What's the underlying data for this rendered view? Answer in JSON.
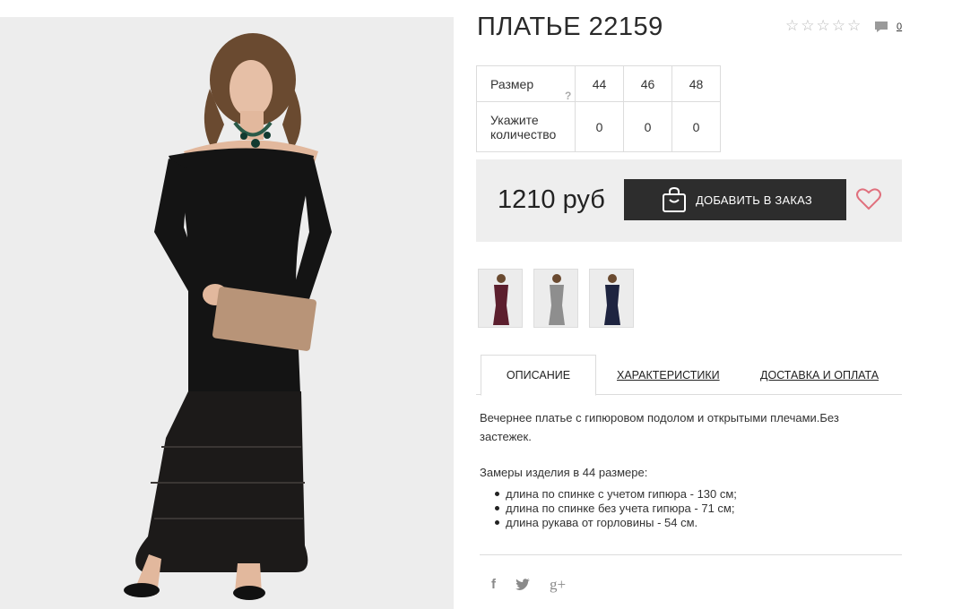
{
  "product": {
    "title": "ПЛАТЬЕ 22159",
    "rating_stars": 5,
    "rating_value": 0,
    "comment_count": "0"
  },
  "size_table": {
    "size_label": "Размер",
    "help_mark": "?",
    "sizes": [
      "44",
      "46",
      "48"
    ],
    "qty_label": "Укажите количество",
    "quantities": [
      "0",
      "0",
      "0"
    ]
  },
  "purchase": {
    "price": "1210 руб",
    "add_button_label": "ДОБАВИТЬ В ЗАКАЗ",
    "heart_color": "#e0707d"
  },
  "thumbnails": [
    {
      "name": "thumb-burgundy",
      "color": "#5c1f2e"
    },
    {
      "name": "thumb-grey",
      "color": "#8e8e8e"
    },
    {
      "name": "thumb-navy",
      "color": "#1e2440"
    }
  ],
  "tabs": [
    {
      "label": "ОПИСАНИЕ",
      "active": true
    },
    {
      "label": "ХАРАКТЕРИСТИКИ",
      "active": false
    },
    {
      "label": "ДОСТАВКА И ОПЛАТА",
      "active": false
    }
  ],
  "description": {
    "text": "Вечернее платье с гипюровом подолом и открытыми плечами.Без застежек.",
    "measures_title": "Замеры изделия в 44 размере:",
    "measures": [
      "длина по спинке с учетом гипюра - 130 см;",
      "длина по спинке без учета гипюра - 71 см;",
      "длина рукава от горловины - 54 см."
    ]
  },
  "social": {
    "facebook": "f",
    "twitter": "twitter-icon",
    "googleplus": "g+"
  }
}
